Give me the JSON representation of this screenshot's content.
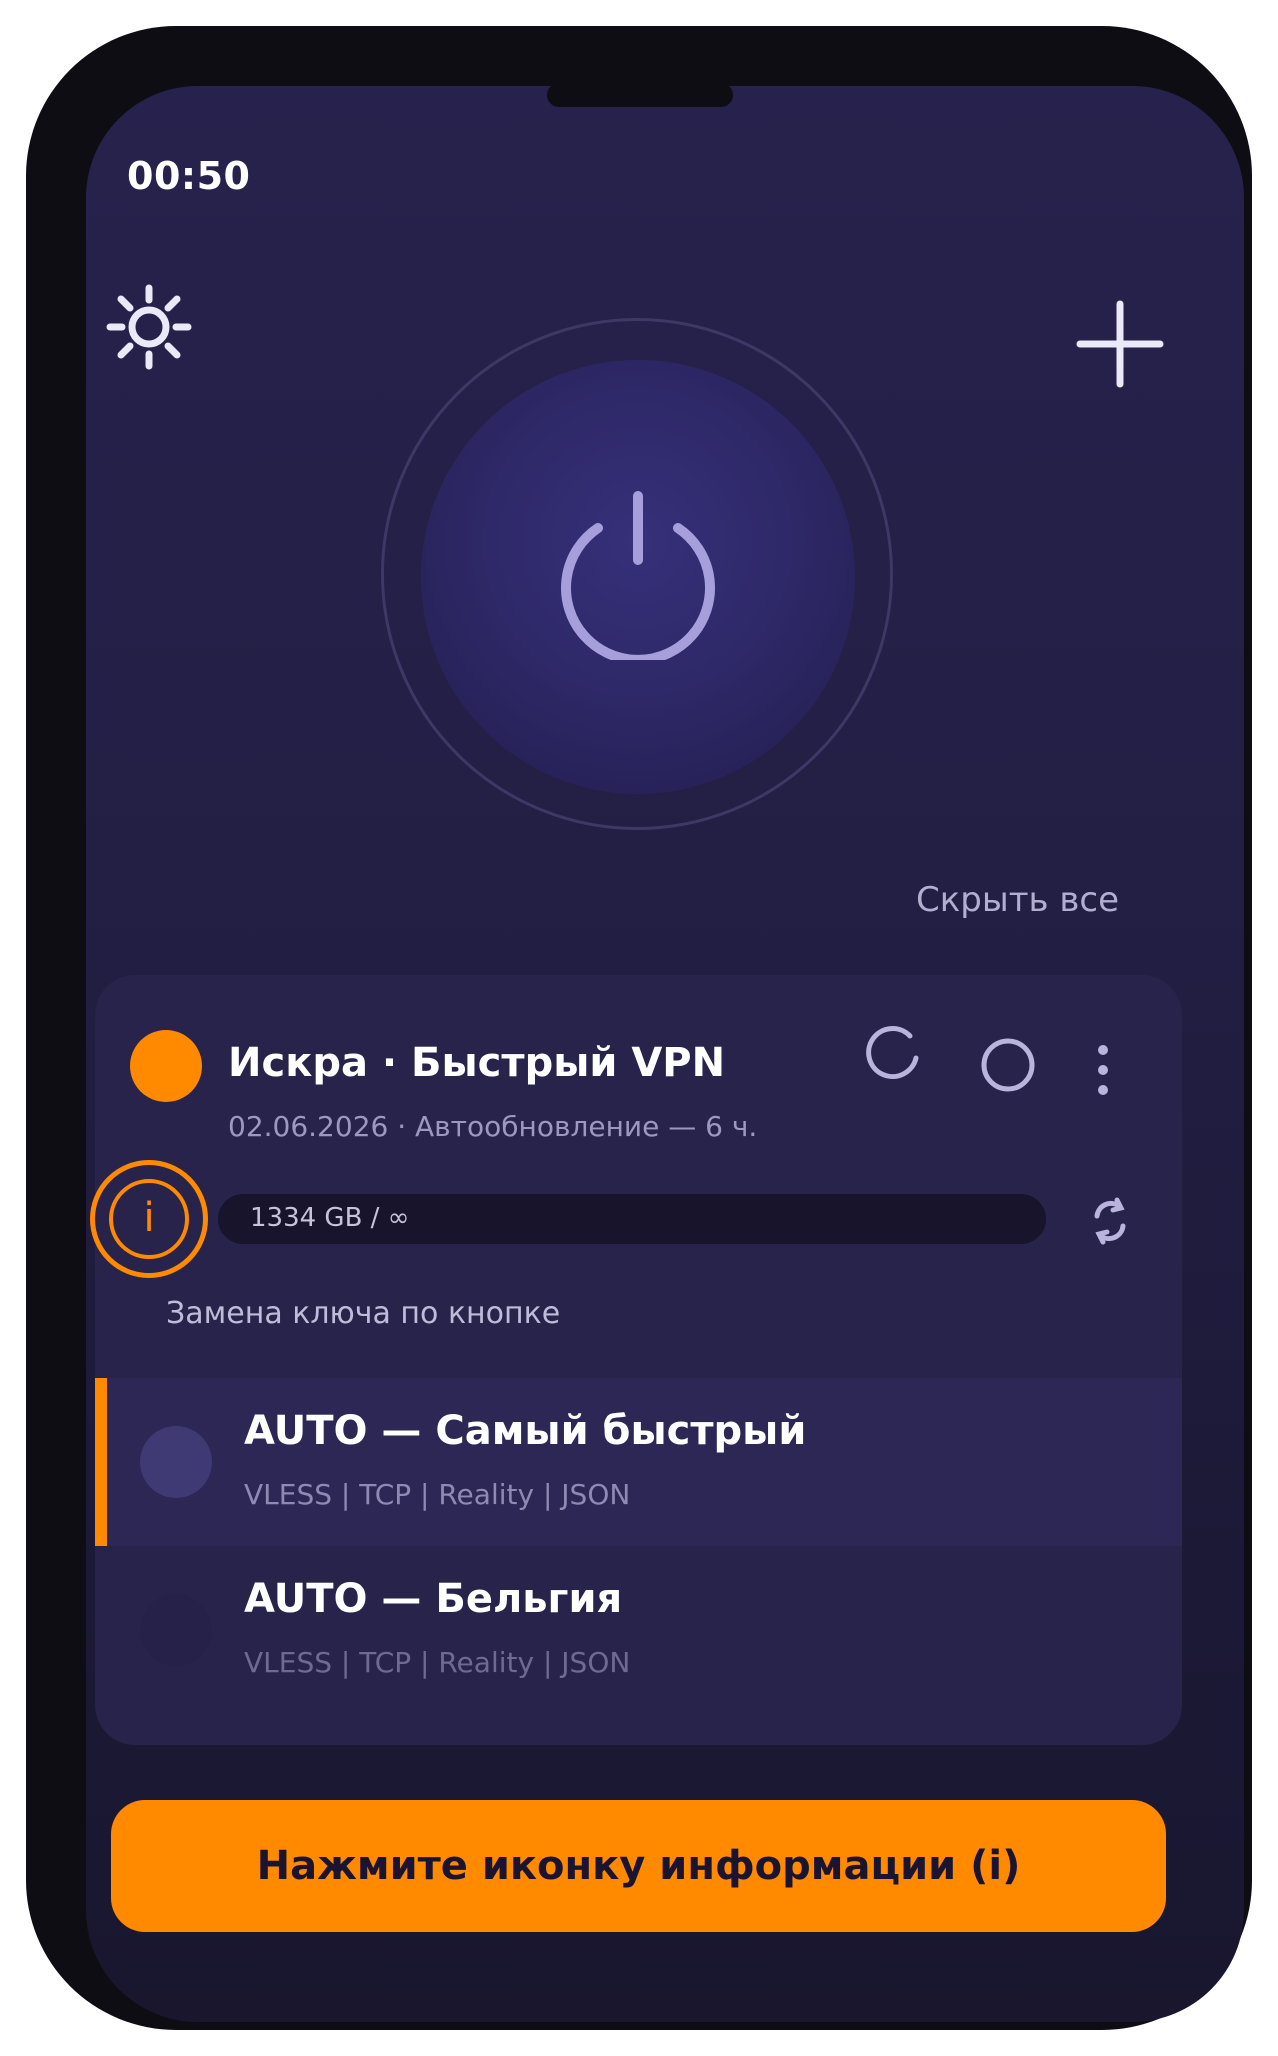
{
  "status_bar": {
    "time": "00:50"
  },
  "header": {
    "settings_icon": "sun-gear-icon",
    "add_icon": "plus-icon"
  },
  "power": {
    "icon": "power-icon",
    "state": "off"
  },
  "hide_all_label": "Скрыть все",
  "subscription": {
    "title": "Искра · Быстрый VPN",
    "meta": "02.06.2026 · Автообновление — 6 ч.",
    "usage": "1334 GB / ∞",
    "key_note": "Замена ключа по кнопке",
    "info_label": "i",
    "accent_color": "#ff8a00"
  },
  "servers": [
    {
      "name": "AUTO — Самый быстрый",
      "tags": "VLESS | TCP | Reality | JSON",
      "selected": true
    },
    {
      "name": "AUTO — Бельгия",
      "tags": "VLESS | TCP | Reality | JSON",
      "selected": false
    }
  ],
  "cta_label": "Нажмите иконку информации (i)",
  "colors": {
    "background": "#221e43",
    "accent": "#ff8a00",
    "card": "#27234b"
  }
}
